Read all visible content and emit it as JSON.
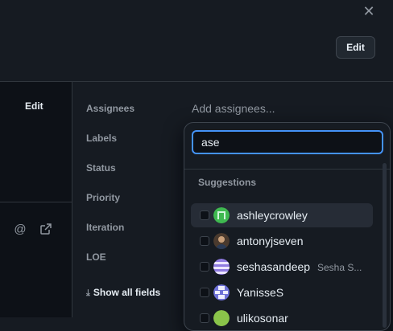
{
  "header": {
    "close_icon": "close-icon",
    "edit_label": "Edit"
  },
  "left_panel": {
    "edit_label": "Edit",
    "icons": [
      "mention-icon",
      "link-external-icon"
    ]
  },
  "fields": {
    "assignees": "Assignees",
    "assignees_placeholder": "Add assignees...",
    "labels": "Labels",
    "status": "Status",
    "priority": "Priority",
    "iteration": "Iteration",
    "loe": "LOE",
    "show_all": "Show all fields"
  },
  "dropdown": {
    "search_value": "ase",
    "suggestions_label": "Suggestions",
    "items": [
      {
        "username": "ashleycrowley",
        "fullname": "",
        "checked": false,
        "active": true
      },
      {
        "username": "antonyjseven",
        "fullname": "",
        "checked": false,
        "active": false
      },
      {
        "username": "seshasandeep",
        "fullname": "Sesha S...",
        "checked": false,
        "active": false
      },
      {
        "username": "YanisseS",
        "fullname": "",
        "checked": false,
        "active": false
      },
      {
        "username": "ulikosonar",
        "fullname": "",
        "checked": false,
        "active": false
      }
    ]
  },
  "colors": {
    "background": "#161b22",
    "focus_border": "#4493f8",
    "muted_text": "#9198a1"
  }
}
